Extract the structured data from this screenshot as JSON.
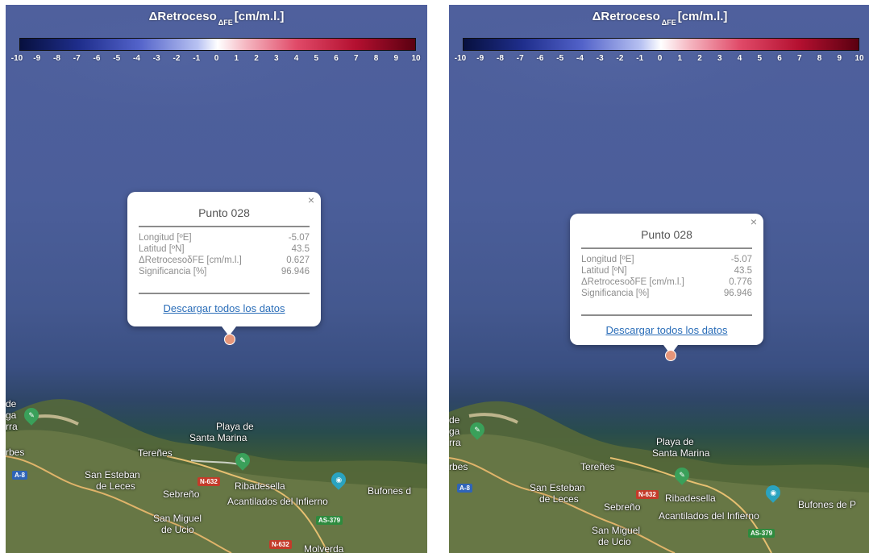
{
  "colorbar": {
    "title_prefix": "ΔRetroceso",
    "title_sub": "ΔFE",
    "title_units": "[cm/m.l.]",
    "ticks": [
      "-10",
      "-9",
      "-8",
      "-7",
      "-6",
      "-5",
      "-4",
      "-3",
      "-2",
      "-1",
      "0",
      "1",
      "2",
      "3",
      "4",
      "5",
      "6",
      "7",
      "8",
      "9",
      "10"
    ],
    "colors": {
      "min": "#07103f",
      "mid": "#ffffff",
      "max": "#5a0010"
    }
  },
  "left_panel": {
    "popup": {
      "title": "Punto 028",
      "rows": [
        {
          "label": "Longitud [ºE]",
          "value": "-5.07"
        },
        {
          "label": "Latitud [ºN]",
          "value": "43.5"
        },
        {
          "label": "ΔRetrocesoδFE [cm/m.l.]",
          "value": "0.627"
        },
        {
          "label": "Significancia [%]",
          "value": "96.946"
        }
      ],
      "download_link": "Descargar todos los datos",
      "close": "×"
    },
    "map_labels": {
      "playa": "Playa de",
      "santa_marina": "Santa Marina",
      "terenes": "Tereñes",
      "san_esteban": "San Esteban",
      "de_leces": "de Leces",
      "sebreno": "Sebreño",
      "ribadesella": "Ribadesella",
      "acantilados": "Acantilados del Infierno",
      "bufones": "Bufones d",
      "san_miguel": "San Miguel",
      "de_ucio": "de Ucio",
      "arbes": "rbes",
      "de": "de",
      "ga": "ga",
      "rra": "rra",
      "molverda": "Molverda"
    },
    "roads": {
      "a8": "A-8",
      "n632a": "N-632",
      "n632b": "N-632",
      "as379": "AS-379"
    }
  },
  "right_panel": {
    "popup": {
      "title": "Punto 028",
      "rows": [
        {
          "label": "Longitud [ºE]",
          "value": "-5.07"
        },
        {
          "label": "Latitud [ºN]",
          "value": "43.5"
        },
        {
          "label": "ΔRetrocesoδFE [cm/m.l.]",
          "value": "0.776"
        },
        {
          "label": "Significancia [%]",
          "value": "96.946"
        }
      ],
      "download_link": "Descargar todos los datos",
      "close": "×"
    },
    "map_labels": {
      "playa": "Playa de",
      "santa_marina": "Santa Marina",
      "terenes": "Tereñes",
      "san_esteban": "San Esteban",
      "de_leces": "de Leces",
      "sebreno": "Sebreño",
      "ribadesella": "Ribadesella",
      "acantilados": "Acantilados del Infierno",
      "bufones": "Bufones de P",
      "san_miguel": "San Miguel",
      "de_ucio": "de Ucio",
      "arbes": "rbes",
      "de": "de",
      "ga": "ga",
      "rra": "rra"
    },
    "roads": {
      "a8": "A-8",
      "n632a": "N-632",
      "as379": "AS-379"
    }
  }
}
